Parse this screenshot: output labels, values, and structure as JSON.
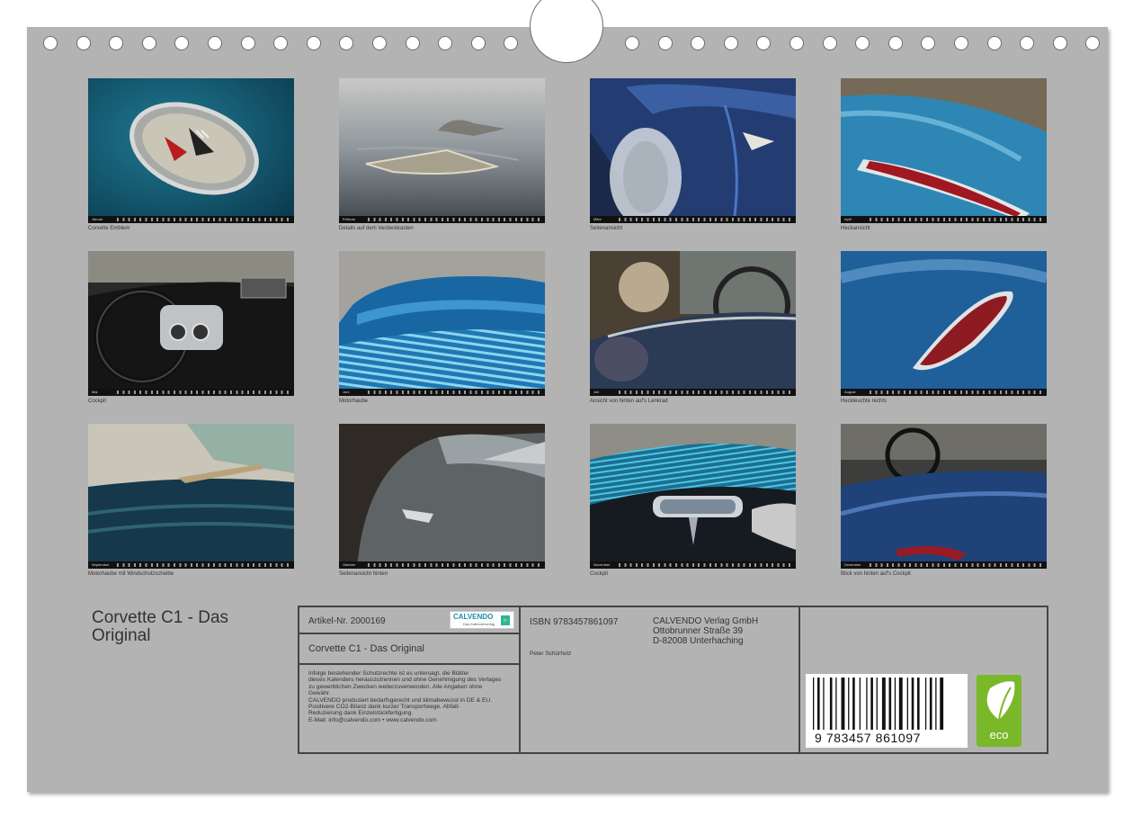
{
  "calendar": {
    "title": "Corvette C1 - Das Original",
    "months": [
      {
        "month": "Januar",
        "caption": "Corvette Emblem",
        "icon": "emblem-photo"
      },
      {
        "month": "Februar",
        "caption": "Details auf dem Verdeckkasten",
        "icon": "detail-photo"
      },
      {
        "month": "März",
        "caption": "Seitenansicht",
        "icon": "side-photo"
      },
      {
        "month": "April",
        "caption": "Heckansicht",
        "icon": "rear-photo"
      },
      {
        "month": "Mai",
        "caption": "Cockpit",
        "icon": "cockpit-photo"
      },
      {
        "month": "Juni",
        "caption": "Motorhaube",
        "icon": "hood-photo"
      },
      {
        "month": "Juli",
        "caption": "Ansicht von hinten auf's Lenkrad",
        "icon": "steering-photo"
      },
      {
        "month": "August",
        "caption": "Heckleuchte rechts",
        "icon": "taillight-photo"
      },
      {
        "month": "September",
        "caption": "Motorhaube mit Windschutzscheibe",
        "icon": "windshield-photo"
      },
      {
        "month": "Oktober",
        "caption": "Seitenansicht hinten",
        "icon": "rear-side-photo"
      },
      {
        "month": "November",
        "caption": "Cockpit",
        "icon": "cockpit-photo"
      },
      {
        "month": "Dezember",
        "caption": "Blick von hinten auf's Cockpit",
        "icon": "rear-cockpit-photo"
      }
    ]
  },
  "info": {
    "article": "Artikel-Nr. 2000169",
    "product_title": "Corvette C1 - Das Original",
    "legal_lines": [
      "Infolge bestehender Schutzrechte ist es untersagt, die Blätter",
      "dieses Kalenders herauszutrennen und ohne Genehmigung des Verlages",
      "zu gewerblichen Zwecken weiterzuverwenden. Alle Angaben ohne",
      "Gewähr.",
      "CALVENDO produziert bedarfsgerecht und klimabewusst in DE & EU.",
      "Positivere CO2-Bilanz dank kurzer Transportwege. Abfall-",
      "Reduzierung dank Einzelstückfertigung.",
      "E-Mail: info@calvendo.com • www.calvendo.com"
    ],
    "isbn": "ISBN 9783457861097",
    "publisher": [
      "CALVENDO Verlag GmbH",
      "Ottobrunner Straße 39",
      "D-82008 Unterhaching"
    ],
    "author": "Peter Schürholz",
    "logo_text": "CALVENDO",
    "logo_tagline": "Das Kalenderverlag",
    "barcode_number": "9 783457 861097",
    "eco_label": "eco"
  },
  "colors": {
    "page": "#b3b3b3",
    "border": "#444444",
    "eco_green": "#79b829",
    "logo_blue": "#1a8ea3"
  }
}
